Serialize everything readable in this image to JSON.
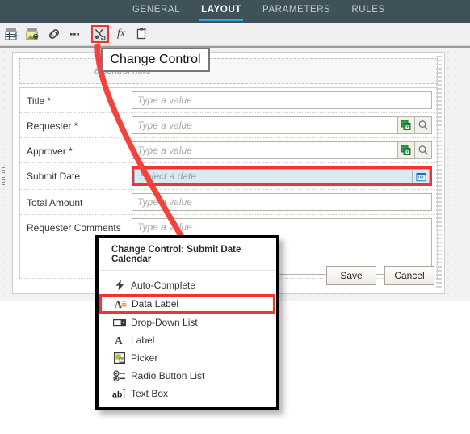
{
  "tabs": [
    {
      "label": "GENERAL",
      "active": false
    },
    {
      "label": "LAYOUT",
      "active": true
    },
    {
      "label": "PARAMETERS",
      "active": false
    },
    {
      "label": "RULES",
      "active": false
    }
  ],
  "toolbar": {
    "buttons": [
      {
        "name": "insert-table-icon",
        "title": "Insert Table"
      },
      {
        "name": "insert-image-icon",
        "title": "Insert Image"
      },
      {
        "name": "link-icon",
        "title": "Link"
      },
      {
        "name": "more-options-icon",
        "title": "More"
      },
      {
        "name": "change-control-icon",
        "title": "Change Control",
        "selected": true
      },
      {
        "name": "formula-icon",
        "title": "fx",
        "glyph": "fx"
      },
      {
        "name": "paste-icon",
        "title": "Paste"
      }
    ]
  },
  "tooltip": {
    "text": "Change Control"
  },
  "canvas": {
    "dropzone_text": "a control here",
    "fields": [
      {
        "label": "Title *",
        "placeholder": "Type a value",
        "type": "text"
      },
      {
        "label": "Requester *",
        "placeholder": "Type a value",
        "type": "picker"
      },
      {
        "label": "Approver *",
        "placeholder": "Type a value",
        "type": "picker"
      },
      {
        "label": "Submit Date",
        "placeholder": "Select a date",
        "type": "date",
        "selected": true
      },
      {
        "label": "Total Amount",
        "placeholder": "Type a value",
        "type": "text"
      },
      {
        "label": "Requester Comments",
        "placeholder": "Type a value",
        "type": "textarea"
      }
    ],
    "buttons": {
      "save_label": "Save",
      "cancel_label": "Cancel"
    }
  },
  "context_menu": {
    "title": "Change Control: Submit Date Calendar",
    "items": [
      {
        "label": "Auto-Complete",
        "icon": "lightning-icon",
        "highlighted": false
      },
      {
        "label": "Data Label",
        "icon": "data-label-icon",
        "highlighted": true
      },
      {
        "label": "Drop-Down List",
        "icon": "dropdown-list-icon",
        "highlighted": false
      },
      {
        "label": "Label",
        "icon": "label-icon",
        "highlighted": false
      },
      {
        "label": "Picker",
        "icon": "picker-icon",
        "highlighted": false
      },
      {
        "label": "Radio Button List",
        "icon": "radio-list-icon",
        "highlighted": false
      },
      {
        "label": "Text Box",
        "icon": "text-box-icon",
        "highlighted": false
      }
    ]
  },
  "colors": {
    "header_bg": "#3f5159",
    "active_tab_underline": "#2fa8e0",
    "highlight_red": "#f03434",
    "arrow_red": "#f4433c",
    "selected_field_bg": "#dce8f2"
  }
}
